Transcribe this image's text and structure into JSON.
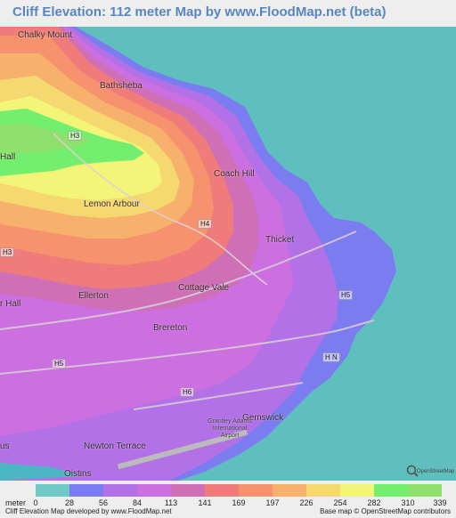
{
  "title": "Cliff Elevation: 112 meter Map by www.FloodMap.net (beta)",
  "places": [
    {
      "id": "chalky-mount",
      "label": "Chalky Mount"
    },
    {
      "id": "bathsheba",
      "label": "Bathsheba"
    },
    {
      "id": "coach-hill",
      "label": "Coach Hill"
    },
    {
      "id": "lemon-arbour",
      "label": "Lemon Arbour"
    },
    {
      "id": "thicket",
      "label": "Thicket"
    },
    {
      "id": "cottage-vale",
      "label": "Cottage Vale"
    },
    {
      "id": "ellerton",
      "label": "Ellerton"
    },
    {
      "id": "hall-west",
      "label": "r Hall"
    },
    {
      "id": "hall-north",
      "label": "Hall"
    },
    {
      "id": "brereton",
      "label": "Brereton"
    },
    {
      "id": "gemswick",
      "label": "Gemswick"
    },
    {
      "id": "newton-terrace",
      "label": "Newton Terrace"
    },
    {
      "id": "oistins",
      "label": "Oistins"
    },
    {
      "id": "us",
      "label": "us"
    }
  ],
  "roads": [
    "H3",
    "H4",
    "H5",
    "H5",
    "H6",
    "H3",
    "H N"
  ],
  "airport_label": "Grantley Adams International Airport",
  "osm_logo": "OpenStreetMap",
  "legend": {
    "unit": "meter",
    "ticks": [
      "0",
      "28",
      "56",
      "84",
      "113",
      "141",
      "169",
      "197",
      "226",
      "254",
      "282",
      "310",
      "339"
    ],
    "colors": [
      "#70c9c6",
      "#7a7cf0",
      "#b271e6",
      "#cc6fe0",
      "#cf6fb6",
      "#f07b7b",
      "#f7926f",
      "#f7b16c",
      "#f5d86f",
      "#f2f578",
      "#74ee6e",
      "#8fe06c"
    ]
  },
  "footer": {
    "left": "Cliff Elevation Map developed by www.FloodMap.net",
    "right": "Base map © OpenStreetMap contributors"
  }
}
